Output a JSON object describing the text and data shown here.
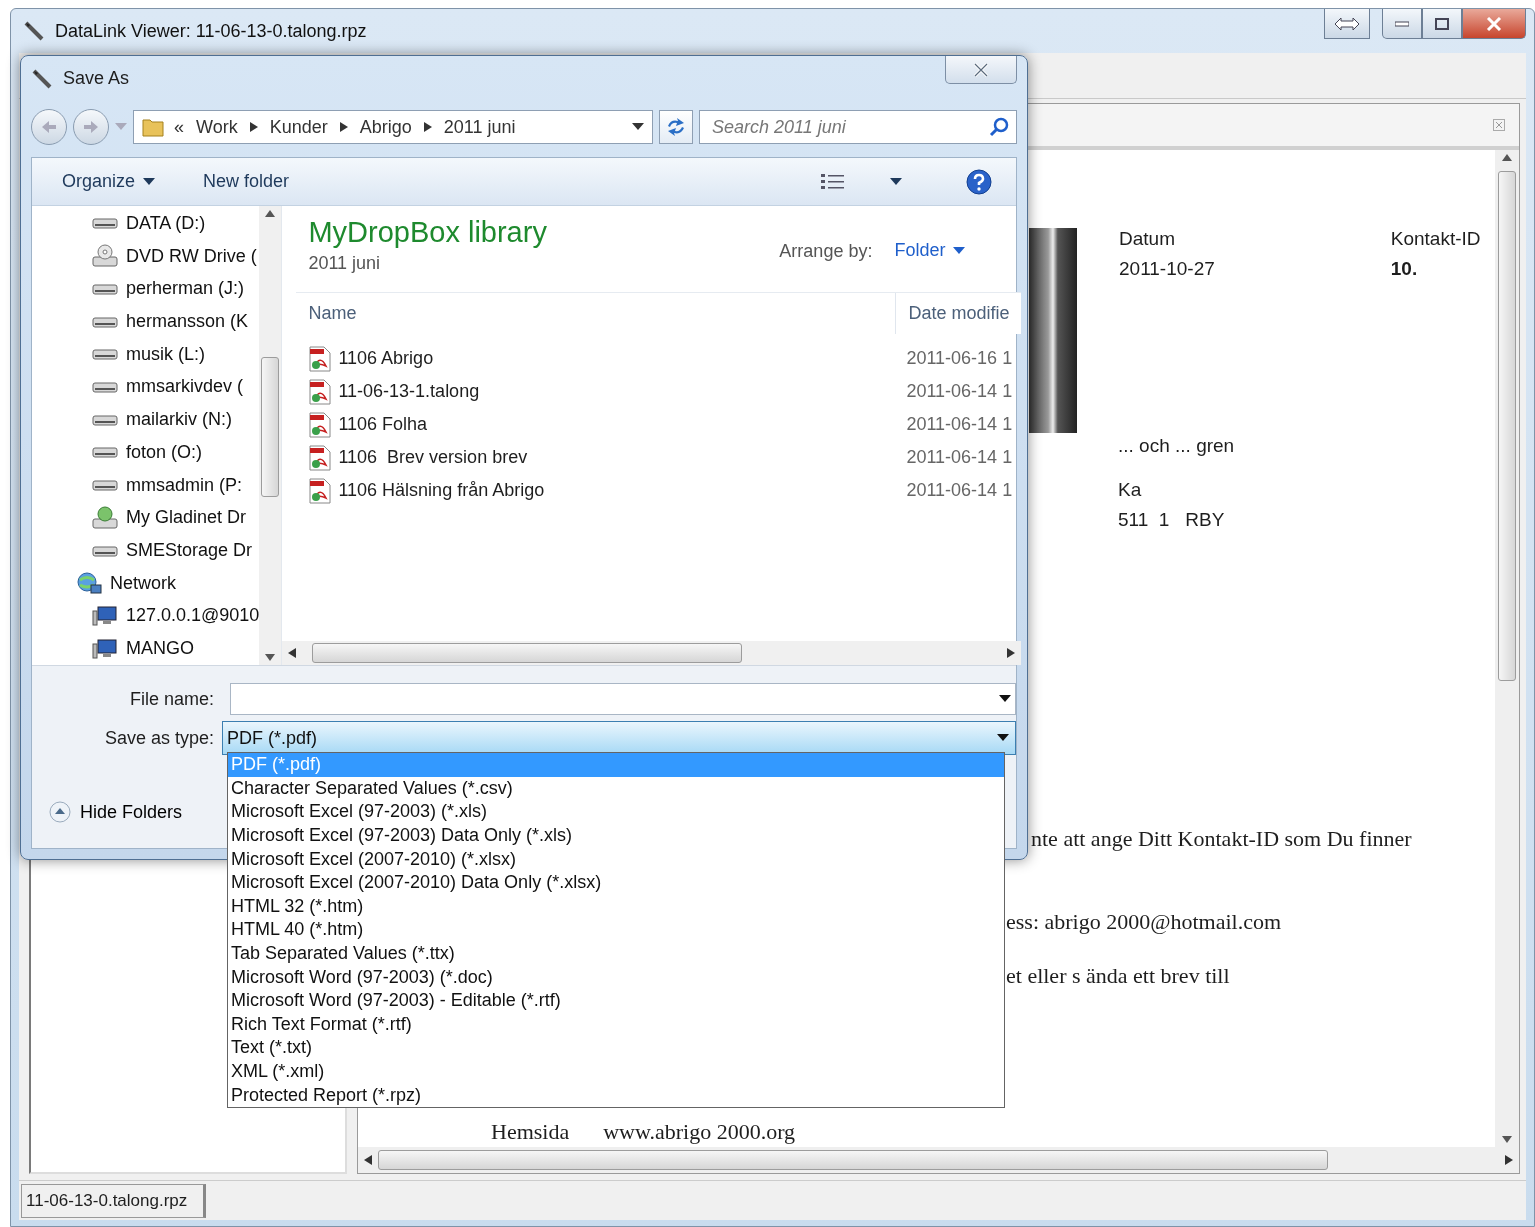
{
  "window": {
    "title": "DataLink Viewer: 11-06-13-0.talong.rpz"
  },
  "document": {
    "date_label": "Datum",
    "date": "2011-10-27",
    "contact_label": "Kontakt-ID",
    "contact_id": "10.",
    "address_lines": [
      "... och ... gren",
      "Ka",
      "511  1   RBY"
    ],
    "body_lines": [
      "nte att ange Ditt Kontakt-ID som Du finner",
      "ess: abrigo 2000@hotmail.com",
      "et eller s ända ett brev till"
    ],
    "footer": {
      "label": "Hemsida",
      "url": "www.abrigo 2000.org"
    }
  },
  "status_bar": "11-06-13-0.talong.rpz",
  "dialog": {
    "title": "Save As",
    "breadcrumb_overflow": "«",
    "breadcrumb": [
      "Work",
      "Kunder",
      "Abrigo",
      "2011 juni"
    ],
    "search": {
      "placeholder": "Search 2011 juni"
    },
    "toolbar": [
      {
        "label": "Organize",
        "kind": "menu"
      },
      {
        "label": "New folder",
        "kind": "button"
      }
    ],
    "tree": [
      {
        "label": "DATA (D:)",
        "kind": "drive"
      },
      {
        "label": "DVD RW Drive (",
        "kind": "dvd"
      },
      {
        "label": "perherman (J:)",
        "kind": "drive"
      },
      {
        "label": "hermansson (K",
        "kind": "drive"
      },
      {
        "label": "musik (L:)",
        "kind": "drive"
      },
      {
        "label": "mmsarkivdev (",
        "kind": "drive"
      },
      {
        "label": "mailarkiv (N:)",
        "kind": "drive"
      },
      {
        "label": "foton (O:)",
        "kind": "drive"
      },
      {
        "label": "mmsadmin (P:",
        "kind": "drive"
      },
      {
        "label": "My Gladinet Dr",
        "kind": "cloud"
      },
      {
        "label": "SMEStorage Dr",
        "kind": "drive"
      },
      {
        "label": "Network",
        "kind": "network",
        "children": [
          {
            "label": "127.0.0.1@9010",
            "kind": "computer"
          },
          {
            "label": "MANGO",
            "kind": "computer"
          }
        ]
      }
    ],
    "library": {
      "title": "MyDropBox library",
      "subtitle": "2011 juni",
      "arrange_label": "Arrange by:",
      "arrange_value": "Folder"
    },
    "columns": [
      "Name",
      "Date modifie"
    ],
    "files": [
      {
        "name": "1106 Abrigo",
        "date": "2011-06-16 1"
      },
      {
        "name": "11-06-13-1.talong",
        "date": "2011-06-14 1"
      },
      {
        "name": "1106 Folha",
        "date": "2011-06-14 1"
      },
      {
        "name": "1106  Brev version brev",
        "date": "2011-06-14 1"
      },
      {
        "name": "1106 Hälsning från Abrigo",
        "date": "2011-06-14 1"
      }
    ],
    "file_name": {
      "label": "File name:"
    },
    "save_type": {
      "label": "Save as type:",
      "value": "PDF (*.pdf)",
      "expanded": true,
      "options": [
        {
          "label": "PDF (*.pdf)",
          "selected": true
        },
        {
          "label": "Character Separated Values (*.csv)",
          "selected": false
        },
        {
          "label": "Microsoft Excel (97-2003) (*.xls)",
          "selected": false
        },
        {
          "label": "Microsoft Excel (97-2003) Data Only (*.xls)",
          "selected": false
        },
        {
          "label": "Microsoft Excel (2007-2010) (*.xlsx)",
          "selected": false
        },
        {
          "label": "Microsoft Excel (2007-2010) Data Only (*.xlsx)",
          "selected": false
        },
        {
          "label": "HTML 32 (*.htm)",
          "selected": false
        },
        {
          "label": "HTML 40 (*.htm)",
          "selected": false
        },
        {
          "label": "Tab Separated Values (*.ttx)",
          "selected": false
        },
        {
          "label": "Microsoft Word (97-2003) (*.doc)",
          "selected": false
        },
        {
          "label": "Microsoft Word (97-2003) - Editable (*.rtf)",
          "selected": false
        },
        {
          "label": "Rich Text Format (*.rtf)",
          "selected": false
        },
        {
          "label": "Text (*.txt)",
          "selected": false
        },
        {
          "label": "XML (*.xml)",
          "selected": false
        },
        {
          "label": "Protected Report (*.rpz)",
          "selected": false
        }
      ]
    },
    "hide_folders": "Hide Folders"
  }
}
